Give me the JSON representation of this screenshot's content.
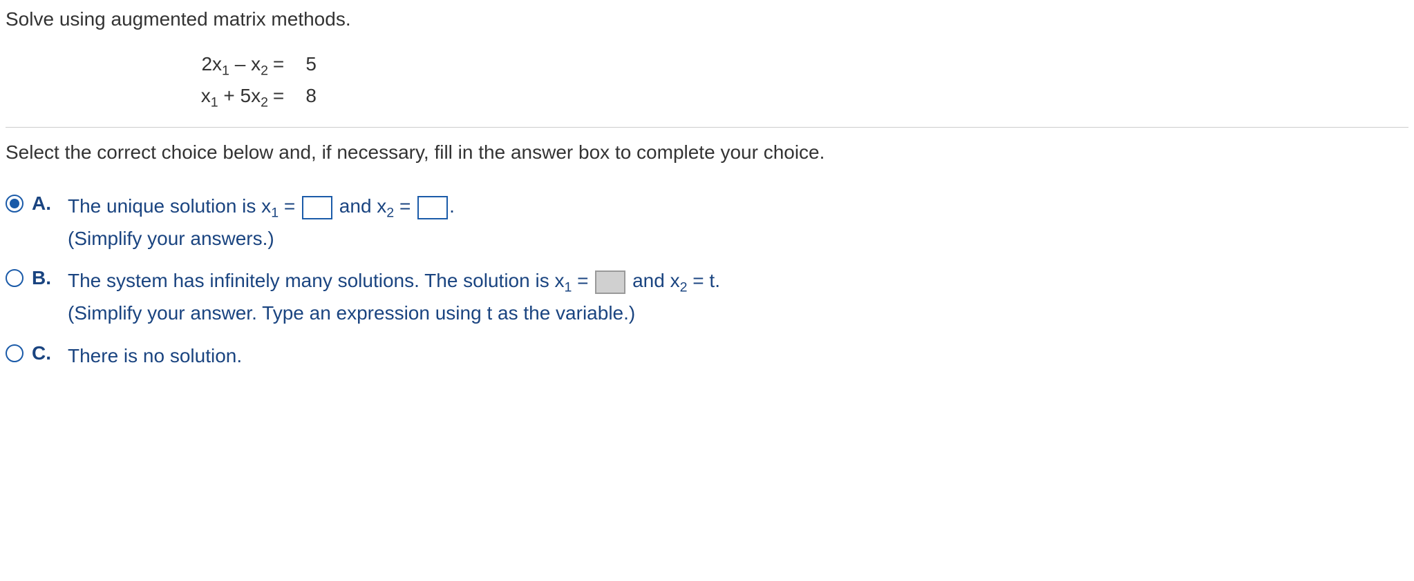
{
  "prompt": "Solve using augmented matrix methods.",
  "equations": [
    {
      "lhs_html": "2x<sub>1</sub> –   x<sub>2</sub>",
      "eq": "=",
      "rhs": "5"
    },
    {
      "lhs_html": "x<sub>1</sub> + 5x<sub>2</sub>",
      "eq": "=",
      "rhs": "8"
    }
  ],
  "instruction": "Select the correct choice below and, if necessary, fill in the answer box to complete your choice.",
  "choices": {
    "A": {
      "label": "A.",
      "line1_pre": "The unique solution is x",
      "line1_sub1": "1",
      "line1_mid1": " = ",
      "line1_mid2": " and x",
      "line1_sub2": "2",
      "line1_mid3": " = ",
      "line1_post": ".",
      "line2": "(Simplify your answers.)"
    },
    "B": {
      "label": "B.",
      "line1_pre": "The system has infinitely many solutions. The solution is x",
      "line1_sub1": "1",
      "line1_mid1": " = ",
      "line1_mid2": " and x",
      "line1_sub2": "2",
      "line1_mid3": " = t.",
      "line2": "(Simplify your answer. Type an expression using t as the variable.)"
    },
    "C": {
      "label": "C.",
      "text": "There is no solution."
    }
  }
}
